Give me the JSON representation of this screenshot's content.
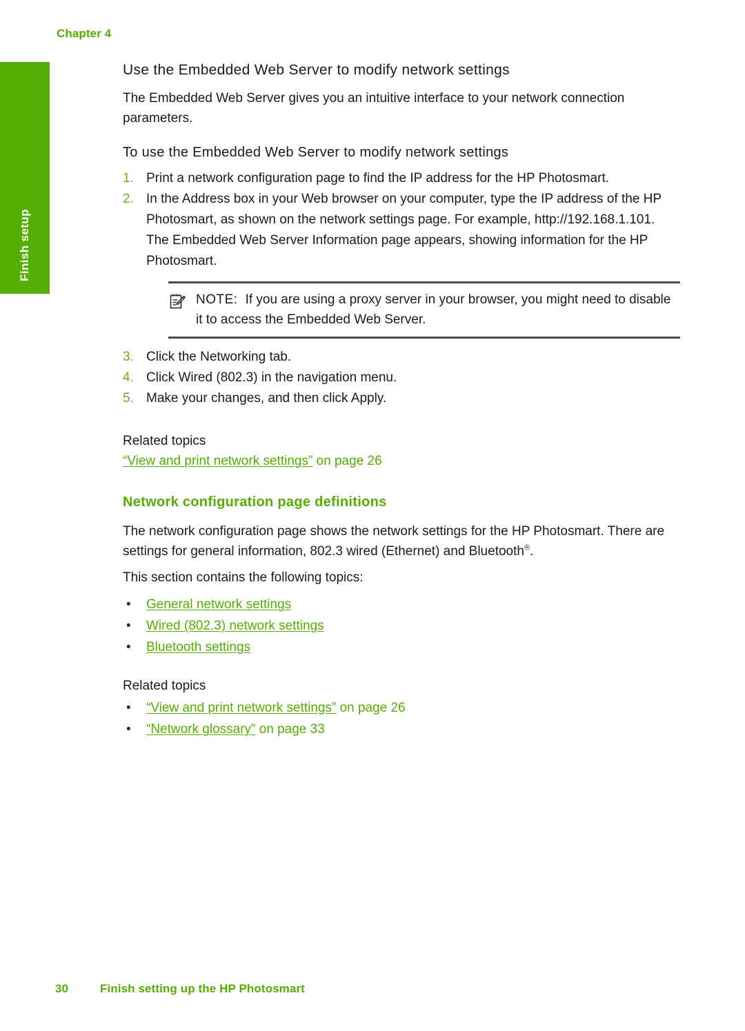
{
  "theme": {
    "accent_green": "#53ae00",
    "tab_green": "#52ae00",
    "body_text": "#1a1a1a",
    "rule_color": "#4a4a4a"
  },
  "header": {
    "chapter_label": "Chapter 4"
  },
  "side_tab": {
    "label": "Finish setup"
  },
  "sections": {
    "ews": {
      "heading": "Use the Embedded Web Server to modify network settings",
      "intro": "The Embedded Web Server gives you an intuitive interface to your network connection parameters.",
      "procedure_heading": "To use the Embedded Web Server to modify network settings",
      "steps": [
        {
          "num": "1.",
          "text": "Print a network configuration page to find the IP address for the HP Photosmart."
        },
        {
          "num": "2.",
          "text": "In the Address box in your Web browser on your computer, type the IP address of the HP Photosmart, as shown on the network settings page. For example, http://192.168.1.101."
        },
        {
          "num": "3.",
          "text": "Click the Networking tab."
        },
        {
          "num": "4.",
          "text": "Click Wired (802.3) in the navigation menu."
        },
        {
          "num": "5.",
          "text": "Make your changes, and then click Apply."
        }
      ],
      "step2_result": "The Embedded Web Server Information page appears, showing information for the HP Photosmart.",
      "note": {
        "icon": "note-pencil-icon",
        "keyword": "NOTE:",
        "text": "If you are using a proxy server in your browser, you might need to disable it to access the Embedded Web Server."
      },
      "related_label": "Related topics",
      "related_link": {
        "link_text": "“View and print network settings”",
        "suffix": " on page 26"
      }
    },
    "netcfg": {
      "heading": "Network configuration page definitions",
      "para1_a": "The network configuration page shows the network settings for the HP Photosmart. There are settings for general information, 802.3 wired (Ethernet) and Bluetooth",
      "para1_sup": "®",
      "para1_b": ".",
      "para2": "This section contains the following topics:",
      "topic_links": [
        {
          "bullet": "•",
          "text": "General network settings"
        },
        {
          "bullet": "•",
          "text": "Wired (802.3) network settings"
        },
        {
          "bullet": "•",
          "text": "Bluetooth settings"
        }
      ],
      "related_label": "Related topics",
      "related_links": [
        {
          "bullet": "•",
          "link_text": "“View and print network settings”",
          "suffix": " on page 26"
        },
        {
          "bullet": "•",
          "link_text": "“Network glossary”",
          "suffix": " on page 33"
        }
      ]
    }
  },
  "footer": {
    "page_number": "30",
    "running_title": "Finish setting up the HP Photosmart"
  }
}
